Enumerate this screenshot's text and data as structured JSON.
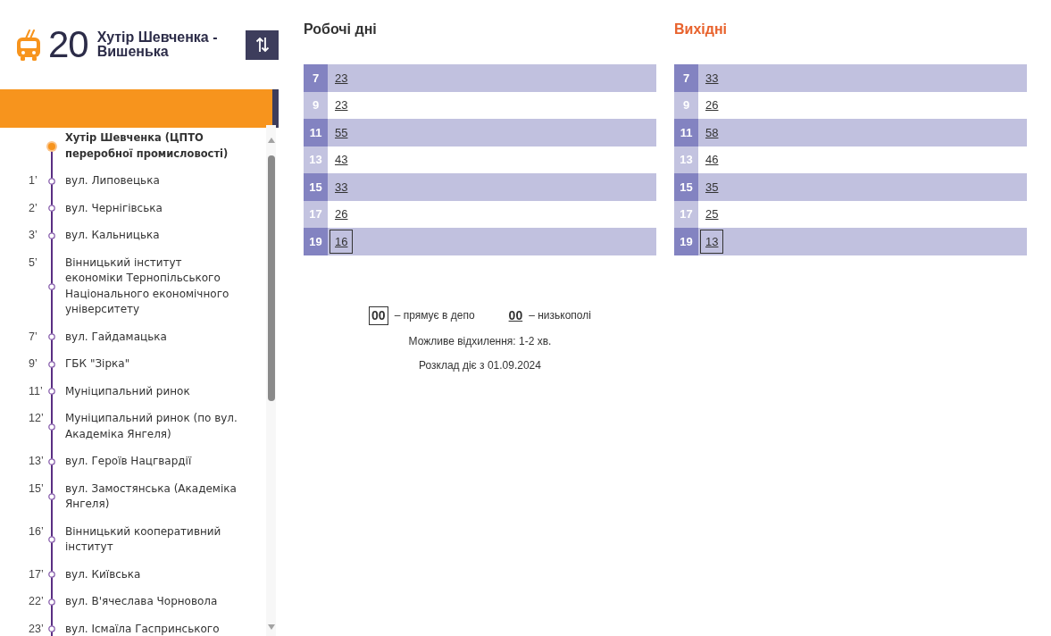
{
  "route": {
    "number": "20",
    "title": "Хутір Шевченка - Вишенька"
  },
  "stops": [
    {
      "kind": "terminus",
      "name": "Хутір Шевченка (ЦПТО переробної промисловості)"
    },
    {
      "kind": "stop",
      "time": "1’",
      "name": "вул. Липовецька"
    },
    {
      "kind": "stop",
      "time": "2’",
      "name": "вул. Чернігівська"
    },
    {
      "kind": "stop",
      "time": "3’",
      "name": "вул. Кальницька"
    },
    {
      "kind": "stop",
      "time": "5’",
      "name": "Вінницький інститут економіки Тернопільського Національного економічного університету"
    },
    {
      "kind": "stop",
      "time": "7’",
      "name": "вул. Гайдамацька"
    },
    {
      "kind": "stop",
      "time": "9’",
      "name": "ГБК \"Зірка\""
    },
    {
      "kind": "stop",
      "time": "11’",
      "name": "Муніципальний ринок"
    },
    {
      "kind": "stop",
      "time": "12’",
      "name": "Муніципальний ринок (по вул. Академіка Янгеля)"
    },
    {
      "kind": "stop",
      "time": "13’",
      "name": "вул. Героїв Нацгвардії"
    },
    {
      "kind": "stop",
      "time": "15’",
      "name": "вул. Замостянська (Академіка Янгеля)"
    },
    {
      "kind": "stop",
      "time": "16’",
      "name": "Вінницький кооперативний інститут"
    },
    {
      "kind": "stop",
      "time": "17’",
      "name": "вул. Київська"
    },
    {
      "kind": "stop",
      "time": "22’",
      "name": "вул. В'ячеслава Чорновола"
    },
    {
      "kind": "stop",
      "time": "23’",
      "name": "вул. Ісмаїла Гаспринського"
    }
  ],
  "schedules": [
    {
      "title": "Робочі дні",
      "highlighted": false,
      "rows": [
        {
          "hour": "7",
          "departures": [
            {
              "minute": "23",
              "low_floor": true,
              "to_depot": false
            }
          ]
        },
        {
          "hour": "9",
          "departures": [
            {
              "minute": "23",
              "low_floor": true,
              "to_depot": false
            }
          ]
        },
        {
          "hour": "11",
          "departures": [
            {
              "minute": "55",
              "low_floor": true,
              "to_depot": false
            }
          ]
        },
        {
          "hour": "13",
          "departures": [
            {
              "minute": "43",
              "low_floor": true,
              "to_depot": false
            }
          ]
        },
        {
          "hour": "15",
          "departures": [
            {
              "minute": "33",
              "low_floor": true,
              "to_depot": false
            }
          ]
        },
        {
          "hour": "17",
          "departures": [
            {
              "minute": "26",
              "low_floor": true,
              "to_depot": false
            }
          ]
        },
        {
          "hour": "19",
          "departures": [
            {
              "minute": "16",
              "low_floor": true,
              "to_depot": true
            }
          ]
        }
      ]
    },
    {
      "title": "Вихідні",
      "highlighted": true,
      "rows": [
        {
          "hour": "7",
          "departures": [
            {
              "minute": "33",
              "low_floor": true,
              "to_depot": false
            }
          ]
        },
        {
          "hour": "9",
          "departures": [
            {
              "minute": "26",
              "low_floor": true,
              "to_depot": false
            }
          ]
        },
        {
          "hour": "11",
          "departures": [
            {
              "minute": "58",
              "low_floor": true,
              "to_depot": false
            }
          ]
        },
        {
          "hour": "13",
          "departures": [
            {
              "minute": "46",
              "low_floor": true,
              "to_depot": false
            }
          ]
        },
        {
          "hour": "15",
          "departures": [
            {
              "minute": "35",
              "low_floor": true,
              "to_depot": false
            }
          ]
        },
        {
          "hour": "17",
          "departures": [
            {
              "minute": "25",
              "low_floor": true,
              "to_depot": false
            }
          ]
        },
        {
          "hour": "19",
          "departures": [
            {
              "minute": "13",
              "low_floor": true,
              "to_depot": true
            }
          ]
        }
      ]
    }
  ],
  "legend": [
    {
      "kind": "depot",
      "sample": "00",
      "label": "– прямує в депо"
    },
    {
      "kind": "low_floor",
      "sample": "00",
      "label": "– низькополі"
    }
  ],
  "notes": [
    "Можливе відхилення: 1-2 хв.",
    "Розклад діє з 01.09.2024"
  ]
}
